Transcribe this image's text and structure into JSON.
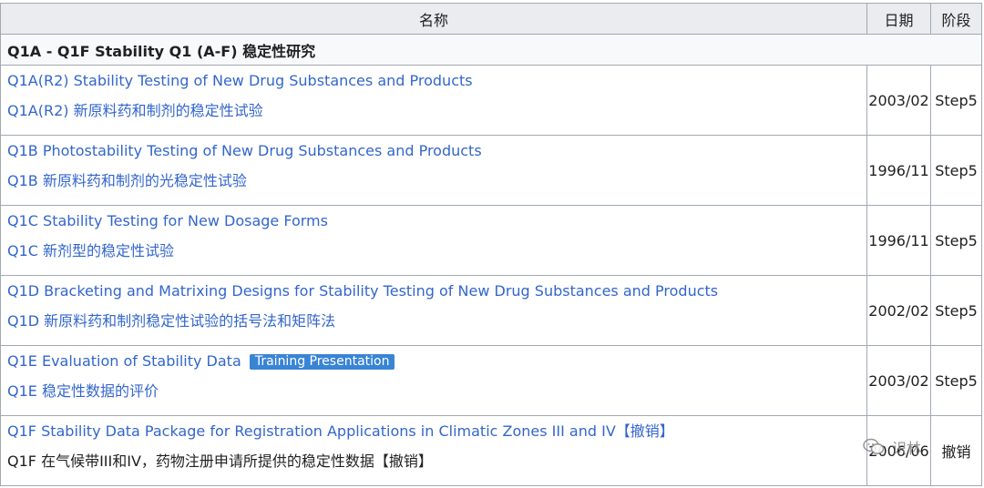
{
  "table": {
    "headers": {
      "name": "名称",
      "date": "日期",
      "stage": "阶段"
    },
    "section_title": "Q1A - Q1F Stability Q1 (A-F) 稳定性研究",
    "rows": [
      {
        "title_en": "Q1A(R2) Stability Testing of New Drug Substances and Products",
        "title_cn": "Q1A(R2) 新原料药和制剂的稳定性试验",
        "date": "2003/02",
        "stage": "Step5"
      },
      {
        "title_en": "Q1B Photostability Testing of New Drug Substances and Products",
        "title_cn": "Q1B 新原料药和制剂的光稳定性试验",
        "date": "1996/11",
        "stage": "Step5"
      },
      {
        "title_en": "Q1C Stability Testing for New Dosage Forms",
        "title_cn": "Q1C 新剂型的稳定性试验",
        "date": "1996/11",
        "stage": "Step5"
      },
      {
        "title_en": "Q1D Bracketing and Matrixing Designs for Stability Testing of New Drug Substances and Products",
        "title_cn": "Q1D 新原料药和制剂稳定性试验的括号法和矩阵法",
        "date": "2002/02",
        "stage": "Step5"
      },
      {
        "title_en": "Q1E Evaluation of Stability Data",
        "badge": "Training Presentation",
        "title_cn": "Q1E 稳定性数据的评价",
        "date": "2003/02",
        "stage": "Step5"
      },
      {
        "title_en": "Q1F Stability Data Package for Registration Applications in Climatic Zones III and IV【撤销】",
        "title_cn": "Q1F 在气候带III和IV，药物注册申请所提供的稳定性数据【撤销】",
        "date": "2006/06",
        "stage": "撤销"
      }
    ]
  },
  "watermark": {
    "text": "识林",
    "icon": "wechat-icon"
  }
}
